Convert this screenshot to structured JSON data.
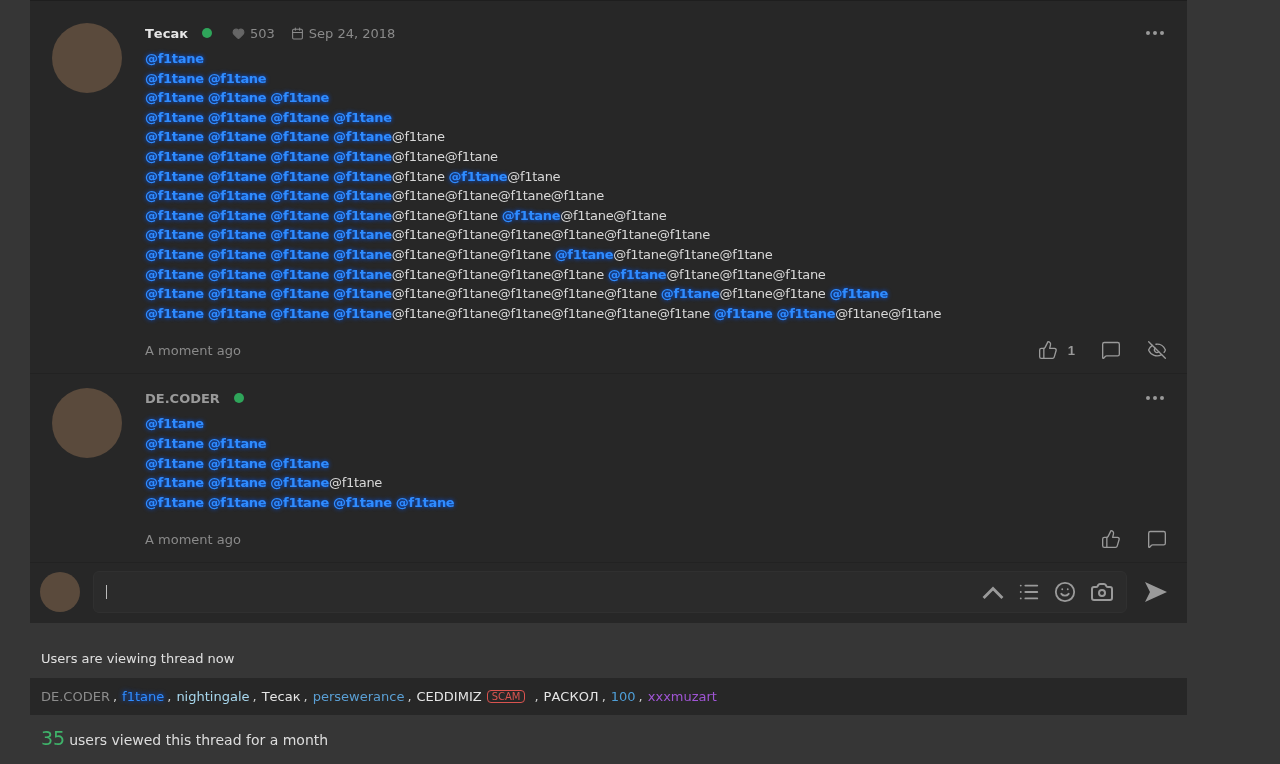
{
  "posts": [
    {
      "author": "Тесак",
      "color": "#e6e6e6",
      "online": true,
      "likes": "503",
      "date": "Sep 24, 2018",
      "time": "A moment ago",
      "lines": [
        [
          {
            "kind": "mention",
            "text": "@f1tane"
          }
        ],
        [
          {
            "kind": "mention",
            "text": "@f1tane"
          },
          {
            "kind": "mention",
            "text": "@f1tane"
          }
        ],
        [
          {
            "kind": "mention",
            "text": "@f1tane"
          },
          {
            "kind": "mention",
            "text": "@f1tane"
          },
          {
            "kind": "mention",
            "text": "@f1tane"
          }
        ],
        [
          {
            "kind": "mention",
            "text": "@f1tane"
          },
          {
            "kind": "mention",
            "text": "@f1tane"
          },
          {
            "kind": "mention",
            "text": "@f1tane"
          },
          {
            "kind": "mention",
            "text": "@f1tane"
          }
        ],
        [
          {
            "kind": "mention",
            "text": "@f1tane"
          },
          {
            "kind": "mention",
            "text": "@f1tane"
          },
          {
            "kind": "mention",
            "text": "@f1tane"
          },
          {
            "kind": "mention",
            "text": "@f1tane"
          },
          {
            "kind": "plain",
            "text": "@f1tane"
          }
        ],
        [
          {
            "kind": "mention",
            "text": "@f1tane"
          },
          {
            "kind": "mention",
            "text": "@f1tane"
          },
          {
            "kind": "mention",
            "text": "@f1tane"
          },
          {
            "kind": "mention",
            "text": "@f1tane"
          },
          {
            "kind": "plain",
            "text": "@f1tane@f1tane"
          }
        ],
        [
          {
            "kind": "mention",
            "text": "@f1tane"
          },
          {
            "kind": "mention",
            "text": "@f1tane"
          },
          {
            "kind": "mention",
            "text": "@f1tane"
          },
          {
            "kind": "mention",
            "text": "@f1tane"
          },
          {
            "kind": "plain",
            "text": "@f1tane "
          },
          {
            "kind": "mention",
            "text": "@f1tane"
          },
          {
            "kind": "plain",
            "text": "@f1tane"
          }
        ],
        [
          {
            "kind": "mention",
            "text": "@f1tane"
          },
          {
            "kind": "mention",
            "text": "@f1tane"
          },
          {
            "kind": "mention",
            "text": "@f1tane"
          },
          {
            "kind": "mention",
            "text": "@f1tane"
          },
          {
            "kind": "plain",
            "text": "@f1tane@f1tane@f1tane@f1tane"
          }
        ],
        [
          {
            "kind": "mention",
            "text": "@f1tane"
          },
          {
            "kind": "mention",
            "text": "@f1tane"
          },
          {
            "kind": "mention",
            "text": "@f1tane"
          },
          {
            "kind": "mention",
            "text": "@f1tane"
          },
          {
            "kind": "plain",
            "text": "@f1tane@f1tane "
          },
          {
            "kind": "mention",
            "text": "@f1tane"
          },
          {
            "kind": "plain",
            "text": "@f1tane@f1tane"
          }
        ],
        [
          {
            "kind": "mention",
            "text": "@f1tane"
          },
          {
            "kind": "mention",
            "text": "@f1tane"
          },
          {
            "kind": "mention",
            "text": "@f1tane"
          },
          {
            "kind": "mention",
            "text": "@f1tane"
          },
          {
            "kind": "plain",
            "text": "@f1tane@f1tane@f1tane@f1tane@f1tane@f1tane"
          }
        ],
        [
          {
            "kind": "mention",
            "text": "@f1tane"
          },
          {
            "kind": "mention",
            "text": "@f1tane"
          },
          {
            "kind": "mention",
            "text": "@f1tane"
          },
          {
            "kind": "mention",
            "text": "@f1tane"
          },
          {
            "kind": "plain",
            "text": "@f1tane@f1tane@f1tane "
          },
          {
            "kind": "mention",
            "text": "@f1tane"
          },
          {
            "kind": "plain",
            "text": "@f1tane@f1tane@f1tane"
          }
        ],
        [
          {
            "kind": "mention",
            "text": "@f1tane"
          },
          {
            "kind": "mention",
            "text": "@f1tane"
          },
          {
            "kind": "mention",
            "text": "@f1tane"
          },
          {
            "kind": "mention",
            "text": "@f1tane"
          },
          {
            "kind": "plain",
            "text": "@f1tane@f1tane@f1tane@f1tane "
          },
          {
            "kind": "mention",
            "text": "@f1tane"
          },
          {
            "kind": "plain",
            "text": "@f1tane@f1tane@f1tane"
          }
        ],
        [
          {
            "kind": "mention",
            "text": "@f1tane"
          },
          {
            "kind": "mention",
            "text": "@f1tane"
          },
          {
            "kind": "mention",
            "text": "@f1tane"
          },
          {
            "kind": "mention",
            "text": "@f1tane"
          },
          {
            "kind": "plain",
            "text": "@f1tane@f1tane@f1tane@f1tane@f1tane "
          },
          {
            "kind": "mention",
            "text": "@f1tane"
          },
          {
            "kind": "plain",
            "text": "@f1tane@f1tane "
          },
          {
            "kind": "mention",
            "text": "@f1tane"
          }
        ],
        [
          {
            "kind": "mention",
            "text": "@f1tane"
          },
          {
            "kind": "mention",
            "text": "@f1tane"
          },
          {
            "kind": "mention",
            "text": "@f1tane"
          },
          {
            "kind": "mention",
            "text": "@f1tane"
          },
          {
            "kind": "plain",
            "text": "@f1tane@f1tane@f1tane@f1tane@f1tane@f1tane "
          },
          {
            "kind": "mention",
            "text": "@f1tane"
          },
          {
            "kind": "mention",
            "text": "@f1tane"
          },
          {
            "kind": "plain",
            "text": "@f1tane@f1tane"
          }
        ]
      ],
      "actions": [
        {
          "kind": "like",
          "count": "1"
        },
        {
          "kind": "reply"
        },
        {
          "kind": "hide"
        }
      ]
    },
    {
      "author": "DE.CODER",
      "color": "#9a9a9a",
      "online": true,
      "time": "A moment ago",
      "lines": [
        [
          {
            "kind": "mention",
            "text": "@f1tane"
          }
        ],
        [
          {
            "kind": "mention",
            "text": "@f1tane"
          },
          {
            "kind": "mention",
            "text": "@f1tane"
          }
        ],
        [
          {
            "kind": "mention",
            "text": "@f1tane"
          },
          {
            "kind": "mention",
            "text": "@f1tane"
          },
          {
            "kind": "mention",
            "text": "@f1tane"
          }
        ],
        [
          {
            "kind": "mention",
            "text": "@f1tane"
          },
          {
            "kind": "mention",
            "text": "@f1tane"
          },
          {
            "kind": "mention",
            "text": "@f1tane"
          },
          {
            "kind": "plain",
            "text": "@f1tane"
          }
        ],
        [
          {
            "kind": "mention",
            "text": "@f1tane"
          },
          {
            "kind": "mention",
            "text": "@f1tane"
          },
          {
            "kind": "mention",
            "text": "@f1tane"
          },
          {
            "kind": "mention",
            "text": "@f1tane"
          },
          {
            "kind": "mention",
            "text": "@f1tane"
          }
        ]
      ],
      "actions": [
        {
          "kind": "like"
        },
        {
          "kind": "reply"
        }
      ]
    }
  ],
  "viewers": {
    "title": "Users are viewing thread now",
    "users": [
      {
        "name": "DE.CODER",
        "color": "#8c8c8c",
        "glow": false,
        "separator": ","
      },
      {
        "name": "f1tane",
        "color": "#2f8cff",
        "glow": true,
        "separator": ","
      },
      {
        "name": "nightingale",
        "color": "#a8d8ee",
        "glow": false,
        "separator": ","
      },
      {
        "name": "Тесак",
        "color": "#e6e6e6",
        "glow": false,
        "separator": ","
      },
      {
        "name": "persewerance",
        "color": "#5a9fd4",
        "glow": false,
        "separator": ","
      },
      {
        "name": "CEDDIMIZ",
        "color": "#e6e6e6",
        "glow": false,
        "badge": "SCAM",
        "separator": ","
      },
      {
        "name": "РАСКОЛ",
        "color": "#e6e6e6",
        "glow": false,
        "separator": ","
      },
      {
        "name": "100",
        "color": "#4f9fd8",
        "glow": false,
        "separator": ","
      },
      {
        "name": "xxxmuzart",
        "color": "#a055d5",
        "glow": false
      }
    ],
    "count": "35",
    "count_text": "users viewed this thread for a month"
  }
}
